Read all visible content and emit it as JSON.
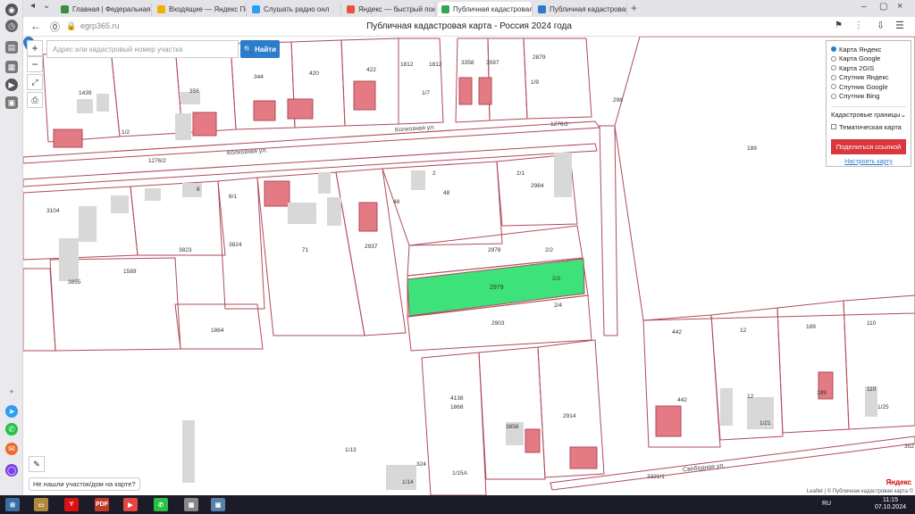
{
  "browser": {
    "tabs": [
      {
        "label": "Главная | Федеральная с",
        "fav": "#3b8f3b"
      },
      {
        "label": "Входящие — Яндекс Почт",
        "fav": "#f0b000"
      },
      {
        "label": "Слушать радио онл",
        "fav": "#2a9df4"
      },
      {
        "label": "Яндекс — быстрый поиск",
        "fav": "#e8533c"
      },
      {
        "label": "Публичная кадастровая",
        "fav": "#2fa84f"
      },
      {
        "label": "Публичная кадастровая",
        "fav": "#2b7ccb"
      }
    ],
    "url": "egrp365.ru",
    "page_title": "Публичная кадастровая карта - Россия 2024 года"
  },
  "map": {
    "search_placeholder": "Адрес или кадастровый номер участка",
    "search_button": "Найти",
    "layers": {
      "options": [
        "Карта Яндекс",
        "Карта Google",
        "Карта 2GIS",
        "Спутник Яндекс",
        "Спутник Google",
        "Спутник Bing"
      ],
      "selected": 0,
      "boundaries": "Кадастровые границы",
      "thematic": "Тематическая карта",
      "share": "Поделиться ссылкой",
      "settings": "Настроить карту"
    },
    "not_found": "Не нашли участок/дом на карте?",
    "attribution": "Leaflet | © Публичная кадастровая карта ©",
    "logo": "Яндекс",
    "streets": {
      "kolhoznaya": "Колхозная ул.",
      "svobodnaya": "Свободная ул.",
      "kolhoznaya2": "Колхозная ул."
    },
    "parcel_labels": [
      {
        "t": "1439"
      },
      {
        "t": "356"
      },
      {
        "t": "344"
      },
      {
        "t": "420"
      },
      {
        "t": "422"
      },
      {
        "t": "1812"
      },
      {
        "t": "1812"
      },
      {
        "t": "3358"
      },
      {
        "t": "3597"
      },
      {
        "t": "2879"
      },
      {
        "t": "1/2"
      },
      {
        "t": "1/7"
      },
      {
        "t": "1/9"
      },
      {
        "t": "1276/2"
      },
      {
        "t": "1276/2"
      },
      {
        "t": "189"
      },
      {
        "t": "298"
      },
      {
        "t": "6"
      },
      {
        "t": "6/1"
      },
      {
        "t": "3104"
      },
      {
        "t": "2"
      },
      {
        "t": "2/1"
      },
      {
        "t": "2984"
      },
      {
        "t": "48"
      },
      {
        "t": "48"
      },
      {
        "t": "3823"
      },
      {
        "t": "3824"
      },
      {
        "t": "71"
      },
      {
        "t": "2937"
      },
      {
        "t": "2978"
      },
      {
        "t": "2/2"
      },
      {
        "t": "1589"
      },
      {
        "t": "3855"
      },
      {
        "t": "2/3"
      },
      {
        "t": "2/4"
      },
      {
        "t": "2903"
      },
      {
        "t": "1864"
      },
      {
        "t": "442"
      },
      {
        "t": "12"
      },
      {
        "t": "189"
      },
      {
        "t": "110"
      },
      {
        "t": "442"
      },
      {
        "t": "12"
      },
      {
        "t": "110"
      },
      {
        "t": "1/21"
      },
      {
        "t": "1/25"
      },
      {
        "t": "4138"
      },
      {
        "t": "1868"
      },
      {
        "t": "3858"
      },
      {
        "t": "2914"
      },
      {
        "t": "1/13"
      },
      {
        "t": "324"
      },
      {
        "t": "1/14"
      },
      {
        "t": "1/15А"
      },
      {
        "t": "3321/1"
      },
      {
        "t": "352"
      },
      {
        "t": "189"
      }
    ],
    "selected_parcel": {
      "label": "2979",
      "color": "#3de37a"
    }
  },
  "taskbar": {
    "lang": "RU",
    "time": "11:15",
    "date": "07.10.2024"
  }
}
